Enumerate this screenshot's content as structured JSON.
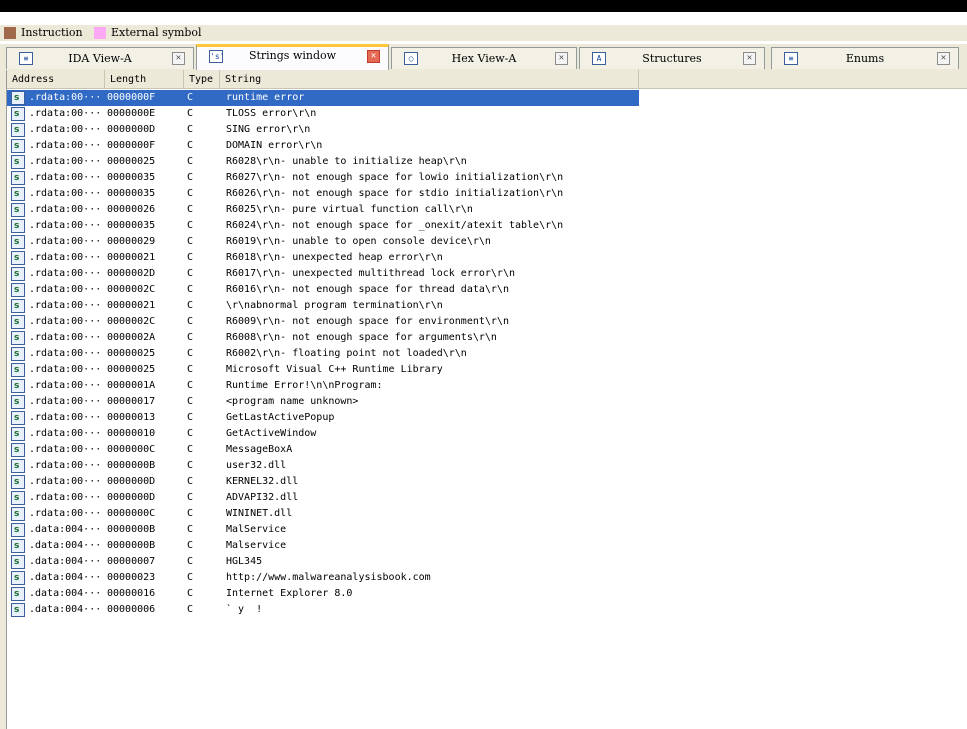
{
  "legend": [
    {
      "label": "Instruction",
      "color": "#a0694b"
    },
    {
      "label": "External symbol",
      "color": "#ffa8f4"
    }
  ],
  "tabs": [
    {
      "label": "IDA View-A",
      "icon": "ida-view-icon",
      "glyph": "≡",
      "active": false
    },
    {
      "label": "Strings window",
      "icon": "strings-icon",
      "glyph": "'s'",
      "active": true
    },
    {
      "label": "Hex View-A",
      "icon": "hex-view-icon",
      "glyph": "○",
      "active": false
    },
    {
      "label": "Structures",
      "icon": "structures-icon",
      "glyph": "A",
      "active": false
    },
    {
      "label": "Enums",
      "icon": "enums-icon",
      "glyph": "≡",
      "active": false
    }
  ],
  "table": {
    "columns": [
      "Address",
      "Length",
      "Type",
      "String"
    ],
    "selected_row": 0,
    "rows": [
      {
        "address": ".rdata:00···",
        "length": "0000000F",
        "type": "C",
        "string": "runtime error "
      },
      {
        "address": ".rdata:00···",
        "length": "0000000E",
        "type": "C",
        "string": "TLOSS error\\r\\n"
      },
      {
        "address": ".rdata:00···",
        "length": "0000000D",
        "type": "C",
        "string": "SING error\\r\\n"
      },
      {
        "address": ".rdata:00···",
        "length": "0000000F",
        "type": "C",
        "string": "DOMAIN error\\r\\n"
      },
      {
        "address": ".rdata:00···",
        "length": "00000025",
        "type": "C",
        "string": "R6028\\r\\n- unable to initialize heap\\r\\n"
      },
      {
        "address": ".rdata:00···",
        "length": "00000035",
        "type": "C",
        "string": "R6027\\r\\n- not enough space for lowio initialization\\r\\n"
      },
      {
        "address": ".rdata:00···",
        "length": "00000035",
        "type": "C",
        "string": "R6026\\r\\n- not enough space for stdio initialization\\r\\n"
      },
      {
        "address": ".rdata:00···",
        "length": "00000026",
        "type": "C",
        "string": "R6025\\r\\n- pure virtual function call\\r\\n"
      },
      {
        "address": ".rdata:00···",
        "length": "00000035",
        "type": "C",
        "string": "R6024\\r\\n- not enough space for _onexit/atexit table\\r\\n"
      },
      {
        "address": ".rdata:00···",
        "length": "00000029",
        "type": "C",
        "string": "R6019\\r\\n- unable to open console device\\r\\n"
      },
      {
        "address": ".rdata:00···",
        "length": "00000021",
        "type": "C",
        "string": "R6018\\r\\n- unexpected heap error\\r\\n"
      },
      {
        "address": ".rdata:00···",
        "length": "0000002D",
        "type": "C",
        "string": "R6017\\r\\n- unexpected multithread lock error\\r\\n"
      },
      {
        "address": ".rdata:00···",
        "length": "0000002C",
        "type": "C",
        "string": "R6016\\r\\n- not enough space for thread data\\r\\n"
      },
      {
        "address": ".rdata:00···",
        "length": "00000021",
        "type": "C",
        "string": "\\r\\nabnormal program termination\\r\\n"
      },
      {
        "address": ".rdata:00···",
        "length": "0000002C",
        "type": "C",
        "string": "R6009\\r\\n- not enough space for environment\\r\\n"
      },
      {
        "address": ".rdata:00···",
        "length": "0000002A",
        "type": "C",
        "string": "R6008\\r\\n- not enough space for arguments\\r\\n"
      },
      {
        "address": ".rdata:00···",
        "length": "00000025",
        "type": "C",
        "string": "R6002\\r\\n- floating point not loaded\\r\\n"
      },
      {
        "address": ".rdata:00···",
        "length": "00000025",
        "type": "C",
        "string": "Microsoft Visual C++ Runtime Library"
      },
      {
        "address": ".rdata:00···",
        "length": "0000001A",
        "type": "C",
        "string": "Runtime Error!\\n\\nProgram: "
      },
      {
        "address": ".rdata:00···",
        "length": "00000017",
        "type": "C",
        "string": "<program name unknown>"
      },
      {
        "address": ".rdata:00···",
        "length": "00000013",
        "type": "C",
        "string": "GetLastActivePopup"
      },
      {
        "address": ".rdata:00···",
        "length": "00000010",
        "type": "C",
        "string": "GetActiveWindow"
      },
      {
        "address": ".rdata:00···",
        "length": "0000000C",
        "type": "C",
        "string": "MessageBoxA"
      },
      {
        "address": ".rdata:00···",
        "length": "0000000B",
        "type": "C",
        "string": "user32.dll"
      },
      {
        "address": ".rdata:00···",
        "length": "0000000D",
        "type": "C",
        "string": "KERNEL32.dll"
      },
      {
        "address": ".rdata:00···",
        "length": "0000000D",
        "type": "C",
        "string": "ADVAPI32.dll"
      },
      {
        "address": ".rdata:00···",
        "length": "0000000C",
        "type": "C",
        "string": "WININET.dll"
      },
      {
        "address": ".data:004···",
        "length": "0000000B",
        "type": "C",
        "string": "MalService"
      },
      {
        "address": ".data:004···",
        "length": "0000000B",
        "type": "C",
        "string": "Malservice"
      },
      {
        "address": ".data:004···",
        "length": "00000007",
        "type": "C",
        "string": "HGL345"
      },
      {
        "address": ".data:004···",
        "length": "00000023",
        "type": "C",
        "string": "http://www.malwareanalysisbook.com"
      },
      {
        "address": ".data:004···",
        "length": "00000016",
        "type": "C",
        "string": "Internet Explorer 8.0"
      },
      {
        "address": ".data:004···",
        "length": "00000006",
        "type": "C",
        "string": "` y  !"
      }
    ]
  }
}
